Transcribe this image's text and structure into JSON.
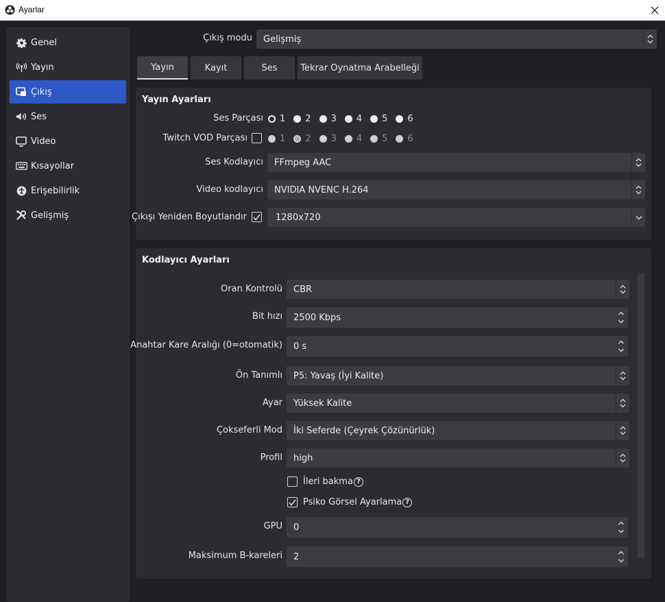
{
  "window": {
    "title": "Ayarlar"
  },
  "sidebar": {
    "items": [
      {
        "label": "Genel",
        "icon": "gear-icon"
      },
      {
        "label": "Yayın",
        "icon": "broadcast-icon"
      },
      {
        "label": "Çıkış",
        "icon": "output-icon",
        "active": true
      },
      {
        "label": "Ses",
        "icon": "speaker-icon"
      },
      {
        "label": "Video",
        "icon": "monitor-icon"
      },
      {
        "label": "Kısayollar",
        "icon": "keyboard-icon"
      },
      {
        "label": "Erişebilirlik",
        "icon": "accessibility-icon"
      },
      {
        "label": "Gelişmiş",
        "icon": "tools-icon"
      }
    ]
  },
  "output_mode": {
    "label": "Çıkış modu",
    "value": "Gelişmiş"
  },
  "tabs": [
    {
      "label": "Yayın",
      "active": true
    },
    {
      "label": "Kayıt"
    },
    {
      "label": "Ses"
    },
    {
      "label": "Tekrar Oynatma Arabelleği"
    }
  ],
  "stream_settings": {
    "title": "Yayın Ayarları",
    "audio_track": {
      "label": "Ses Parçası",
      "options": [
        "1",
        "2",
        "3",
        "4",
        "5",
        "6"
      ],
      "selected": "1"
    },
    "twitch_vod": {
      "label": "Twitch VOD Parçası",
      "checked": false,
      "options": [
        "1",
        "2",
        "3",
        "4",
        "5",
        "6"
      ],
      "selected": "2"
    },
    "audio_encoder": {
      "label": "Ses Kodlayıcı",
      "value": "FFmpeg AAC"
    },
    "video_encoder": {
      "label": "Video kodlayıcı",
      "value": "NVIDIA NVENC H.264"
    },
    "rescale": {
      "label": "Çıkışı Yeniden Boyutlandır",
      "checked": true,
      "value": "1280x720"
    }
  },
  "encoder_settings": {
    "title": "Kodlayıcı Ayarları",
    "rate_control": {
      "label": "Oran Kontrolü",
      "value": "CBR"
    },
    "bitrate": {
      "label": "Bit hızı",
      "value": "2500 Kbps"
    },
    "keyframe": {
      "label": "Anahtar Kare Aralığı (0=otomatik)",
      "value": "0 s"
    },
    "preset": {
      "label": "Ön Tanımlı",
      "value": "P5: Yavaş (İyi Kalite)"
    },
    "tuning": {
      "label": "Ayar",
      "value": "Yüksek Kalite"
    },
    "multipass": {
      "label": "Çokseferli Mod",
      "value": "İki Seferde (Çeyrek Çözünürlük)"
    },
    "profile": {
      "label": "Profil",
      "value": "high"
    },
    "lookahead": {
      "label": "İleri bakma",
      "checked": false
    },
    "psycho": {
      "label": "Psiko Görsel Ayarlama",
      "checked": true
    },
    "gpu": {
      "label": "GPU",
      "value": "0"
    },
    "bframes": {
      "label": "Maksimum B-kareleri",
      "value": "2"
    }
  }
}
